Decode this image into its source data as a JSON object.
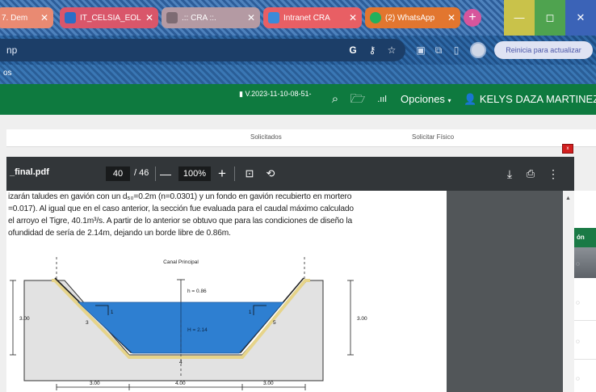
{
  "browser": {
    "tabs": [
      {
        "title": "7. Dem",
        "bg": "#e98a72",
        "icon": "#f3b5a5"
      },
      {
        "title": "IT_CELSIA_EOLI",
        "bg": "#d9566a",
        "icon": "#2b6ec6"
      },
      {
        "title": ".:: CRA ::.",
        "bg": "#b49aa3",
        "icon": "#7d6b73"
      },
      {
        "title": "Intranet CRA",
        "bg": "#e85f64",
        "icon": "#3b8ad9"
      },
      {
        "title": "(2) WhatsApp",
        "bg": "#e2762f",
        "icon": "#22b15c"
      }
    ],
    "new_tab": "+",
    "window_controls": {
      "minimize": "—",
      "maximize": "◻",
      "close": "✕"
    },
    "address": "np",
    "update_button": "Reinicia para actualizar",
    "bookmark": "os"
  },
  "app": {
    "version": "V.2023-11-10-08-51-",
    "menu_opciones": "Opciones",
    "user_name": "KELYS DAZA MARTINEZ",
    "tabs": {
      "solicitados": "Solicitados",
      "solicitar_fisico": "Solicitar Físico"
    },
    "red_badge": "x",
    "side_header": "ón"
  },
  "pdf": {
    "filename": "_final.pdf",
    "current_page": "40",
    "total_pages": "/ 46",
    "zoom": "100%",
    "paragraph": [
      "izarán taludes en gavión con un d₅₀=0.2m (n=0.0301) y un fondo en gavión recubierto en mortero",
      "=0.017). Al igual que en el caso anterior, la sección fue evaluada para el caudal máximo calculado",
      " el arroyo el Tigre, 40.1m³/s. A partir de lo anterior se obtuvo que para las condiciones de diseño la",
      "ofundidad de sería de 2.14m, dejando un borde libre de 0.86m."
    ]
  },
  "figure": {
    "title": "Canal Principal",
    "freeboard": "h = 0.86",
    "water_depth": "H = 2.14",
    "bottom_width_code": "4",
    "left_slope_code": "3",
    "right_slope_code": "5",
    "slope_ratio": "1",
    "height_left": "3.00",
    "height_right": "3.00",
    "width_left": "3.00",
    "width_bottom": "4.00",
    "width_right": "3.00",
    "colors": {
      "water": "#2e7fd1",
      "lining": "#e6d48a",
      "ground": "#e2e2e2"
    }
  }
}
